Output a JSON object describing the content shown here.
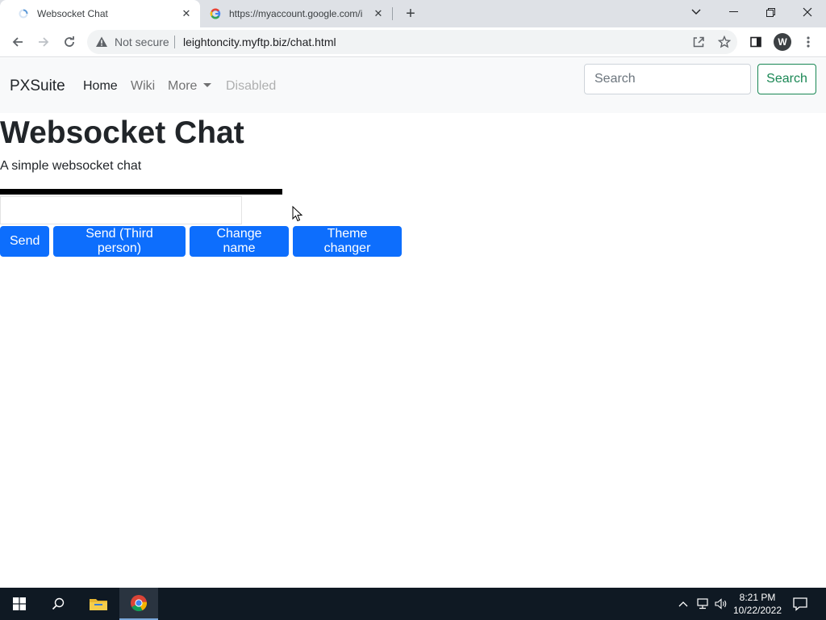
{
  "browser": {
    "tabs": [
      {
        "title": "Websocket Chat"
      },
      {
        "title": "https://myaccount.google.com/i"
      }
    ],
    "security_label": "Not secure",
    "url": "leightoncity.myftp.biz/chat.html",
    "profile_initial": "W"
  },
  "navbar": {
    "brand": "PXSuite",
    "links": [
      "Home",
      "Wiki",
      "More",
      "Disabled"
    ],
    "search_placeholder": "Search",
    "search_button": "Search"
  },
  "main": {
    "title": "Websocket Chat",
    "subtitle": "A simple websocket chat",
    "message_value": "",
    "buttons": [
      "Send",
      "Send (Third person)",
      "Change name",
      "Theme changer"
    ]
  },
  "taskbar": {
    "time": "8:21 PM",
    "date": "10/22/2022"
  },
  "colors": {
    "primary": "#0d6efd",
    "success": "#198754",
    "navbar_bg": "#f8f9fa",
    "taskbar_bg": "#0f1923"
  }
}
